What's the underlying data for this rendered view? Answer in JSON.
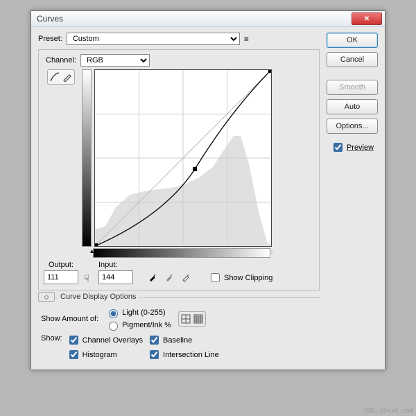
{
  "window": {
    "title": "Curves"
  },
  "preset": {
    "label": "Preset:",
    "value": "Custom"
  },
  "channel": {
    "label": "Channel:",
    "value": "RGB"
  },
  "output": {
    "label": "Output:",
    "value": "111"
  },
  "input": {
    "label": "Input:",
    "value": "144"
  },
  "show_clipping": {
    "label": "Show Clipping",
    "checked": false
  },
  "display_options": {
    "label": "Curve Display Options"
  },
  "show_amount": {
    "label": "Show Amount of:",
    "light": "Light  (0-255)",
    "pigment": "Pigment/Ink %"
  },
  "show": {
    "label": "Show:",
    "channel_overlays": "Channel Overlays",
    "histogram": "Histogram",
    "baseline": "Baseline",
    "intersection": "Intersection Line"
  },
  "buttons": {
    "ok": "OK",
    "cancel": "Cancel",
    "smooth": "Smooth",
    "auto": "Auto",
    "options": "Options..."
  },
  "preview": {
    "label": "Preview"
  },
  "watermark": "BBS.16xx8.com"
}
